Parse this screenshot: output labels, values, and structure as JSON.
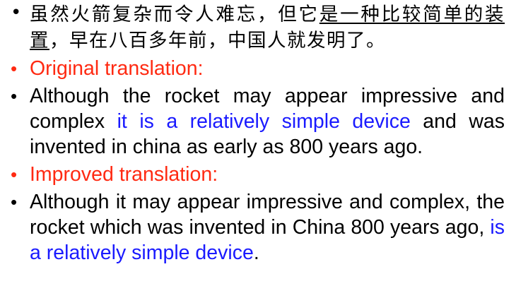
{
  "slide": {
    "zh": {
      "part1": "虽然火箭复杂而令人难忘，但它",
      "part2_underlined": "是一种比较简单的装置",
      "part3": "，早在八百多年前，中国人就发明了。"
    },
    "original_heading": "Original translation:",
    "original": {
      "part1": "Although the rocket may appear impressive and complex ",
      "part2_highlight": "it is a relatively simple device",
      "part3": " and was invented in china as early as 800 years ago."
    },
    "improved_heading": "Improved translation:",
    "improved": {
      "part1": "Although it may appear impressive and complex, the rocket which was invented in China 800 years ago, ",
      "part2_highlight": "is a relatively simple device",
      "part3": "."
    },
    "bullet_glyph": "•"
  },
  "colors": {
    "heading": "#ff2a12",
    "highlight": "#1a1aff",
    "text": "#000000"
  }
}
